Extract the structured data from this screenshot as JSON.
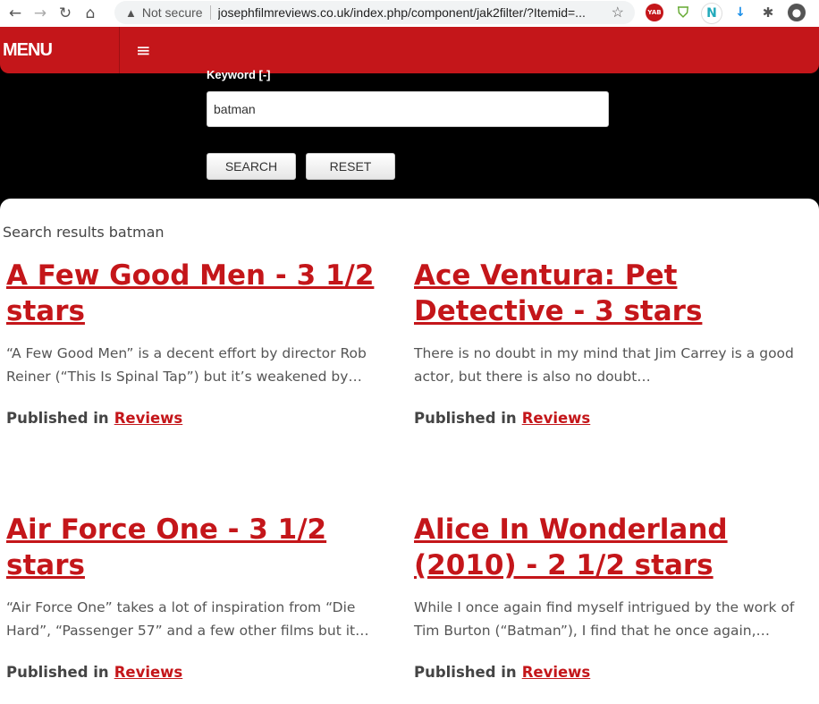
{
  "browser": {
    "not_secure": "Not secure",
    "url": "josephfilmreviews.co.uk/index.php/component/jak2filter/?Itemid=...",
    "ext_yab": "YAB",
    "ext_n": "N"
  },
  "header": {
    "menu_label": "MENU",
    "hamburger": "≡"
  },
  "search": {
    "keyword_label": "Keyword [-]",
    "value": "batman",
    "search_button": "SEARCH",
    "reset_button": "RESET"
  },
  "results": {
    "heading": "Search results batman",
    "published_in": "Published in",
    "items": [
      {
        "title": "A Few Good Men - 3 1/2 stars",
        "excerpt": "“A Few Good Men” is a decent effort by director Rob Reiner (“This Is Spinal Tap”) but it’s weakened by…",
        "category": "Reviews"
      },
      {
        "title": "Ace Ventura: Pet Detective - 3 stars",
        "excerpt": "There is no doubt in my mind that Jim Carrey is a good actor, but there is also no doubt…",
        "category": "Reviews"
      },
      {
        "title": "Air Force One - 3 1/2 stars",
        "excerpt": "“Air Force One” takes a lot of inspiration from “Die Hard”, “Passenger 57” and a few other films but it…",
        "category": "Reviews"
      },
      {
        "title": "Alice In Wonderland (2010) - 2 1/2 stars",
        "excerpt": "While I once again find myself intrigued by the work of Tim Burton (“Batman”), I find that he once again,…",
        "category": "Reviews"
      }
    ]
  }
}
